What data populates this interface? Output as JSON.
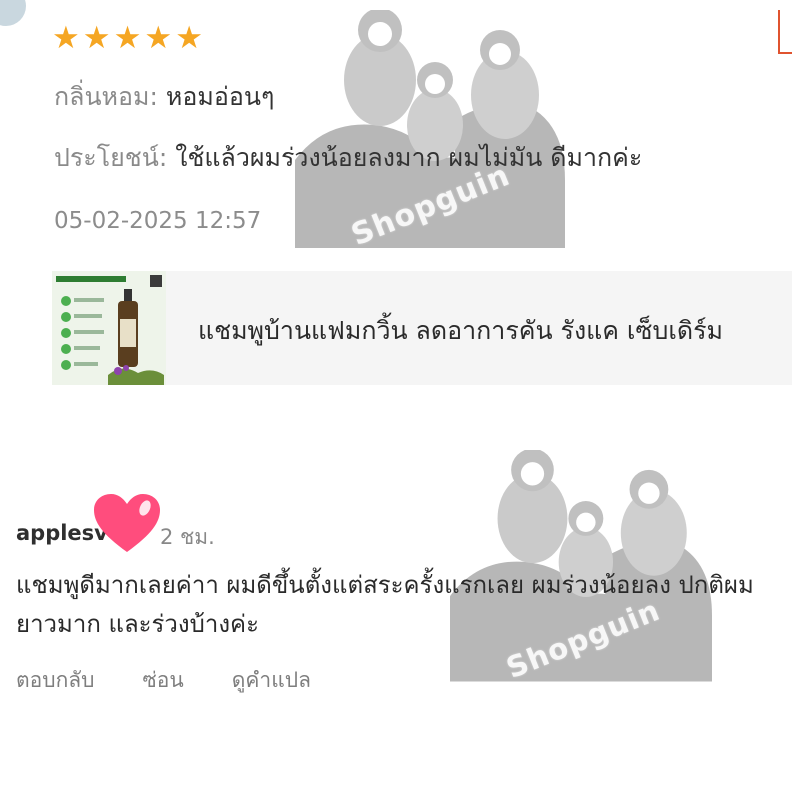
{
  "review": {
    "rating": 5,
    "star_glyph": "★",
    "star_color": "#f5a623",
    "attributes": [
      {
        "key": "กลิ่นหอม:",
        "value": "หอมอ่อนๆ"
      },
      {
        "key": "ประโยชน์:",
        "value": "ใช้แล้วผมร่วงน้อยลงมาก ผมไม่มัน ดีมากค่ะ"
      }
    ],
    "timestamp": "05-02-2025 12:57",
    "product": {
      "name": "แชมพูบ้านแฟมกวิ้น ลดอาการคัน รังแค เซ็บเดิร์ม"
    }
  },
  "comment": {
    "username": "applesv",
    "time_ago": "2 ชม.",
    "text": "แชมพูดีมากเลยค่าา ผมดีขึ้นตั้งแต่สระครั้งแรกเลย ผมร่วงน้อยลง ปกติผมยาวมาก และร่วงบ้างค่ะ",
    "actions": {
      "reply": "ตอบกลับ",
      "hide": "ซ่อน",
      "translate": "ดูคำแปล"
    }
  },
  "watermark": {
    "text": "Shopguin"
  },
  "colors": {
    "heart": "#ff4d7d",
    "accent": "#e0532f",
    "product_green": "#2e7d32"
  }
}
